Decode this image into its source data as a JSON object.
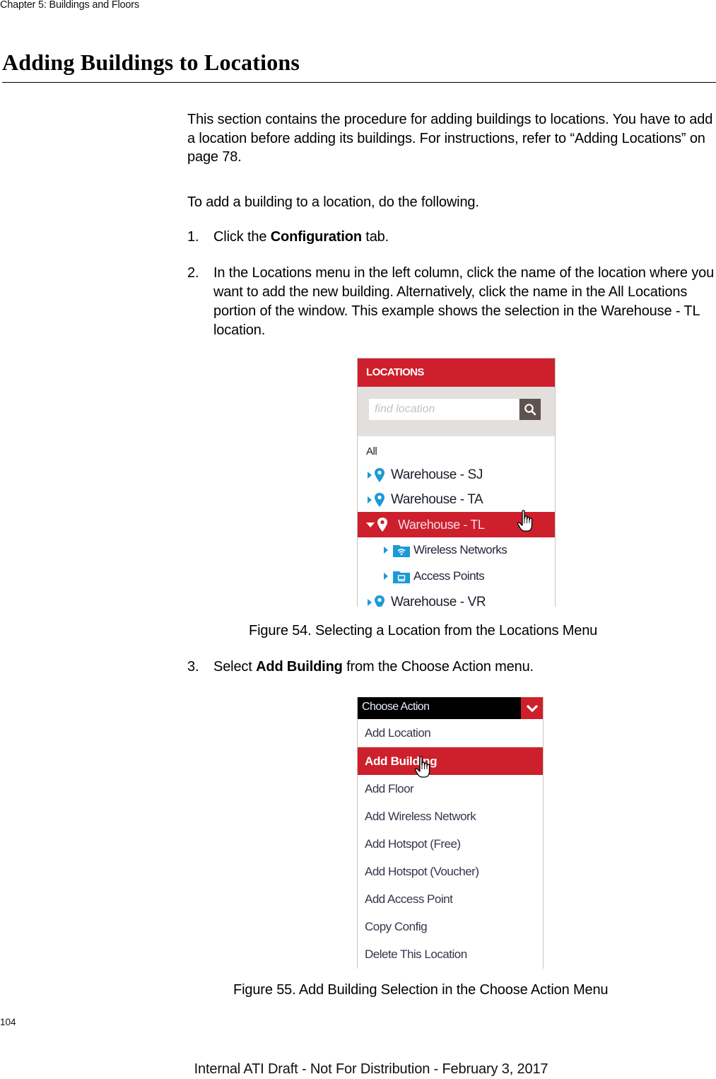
{
  "page": {
    "chapter_header": "Chapter 5: Buildings and Floors",
    "section_title": "Adding Buildings to Locations",
    "intro_paragraph": "This section contains the procedure for adding buildings to locations. You have to add a location before adding its buildings. For instructions, refer to “Adding Locations” on page 78.",
    "lead_in": "To add a building to a location, do the following.",
    "steps": [
      {
        "num": "1.",
        "before": "Click the ",
        "bold": "Configuration",
        "after": " tab."
      },
      {
        "num": "2.",
        "text": "In the Locations menu in the left column, click the name of the location where you want to add the new building. Alternatively, click the name in the All Locations portion of the window. This example shows the selection in the Warehouse - TL location."
      },
      {
        "num": "3.",
        "before": "Select ",
        "bold": "Add Building",
        "after": " from the Choose Action menu."
      }
    ],
    "page_number": "104",
    "footer": "Internal ATI Draft - Not For Distribution - February 3, 2017"
  },
  "figure54": {
    "caption": "Figure 54. Selecting a Location from the Locations Menu",
    "panel_title": "LOCATIONS",
    "search_placeholder": "find location",
    "search_icon": "search-icon",
    "all_label": "All",
    "locations": [
      {
        "label": "Warehouse - SJ",
        "icon": "map-pin-icon",
        "expanded": false,
        "selected": false
      },
      {
        "label": "Warehouse - TA",
        "icon": "map-pin-icon",
        "expanded": false,
        "selected": false
      },
      {
        "label": "Warehouse - TL",
        "icon": "map-pin-icon",
        "expanded": true,
        "selected": true,
        "children": [
          {
            "label": "Wireless Networks",
            "icon": "wifi-folder-icon"
          },
          {
            "label": "Access Points",
            "icon": "access-point-folder-icon"
          }
        ]
      },
      {
        "label": "Warehouse - VR",
        "icon": "map-pin-icon",
        "expanded": false,
        "selected": false
      }
    ],
    "colors": {
      "header_red": "#cd202c",
      "search_area": "#e2dfdc",
      "search_button": "#5e5350",
      "icon_blue": "#1b9ad6"
    }
  },
  "figure55": {
    "caption": "Figure 55. Add Building Selection in the Choose Action Menu",
    "menu_title": "Choose Action",
    "toggle_icon": "chevron-down-icon",
    "items": [
      {
        "label": "Add Location",
        "selected": false
      },
      {
        "label": "Add Building",
        "selected": true
      },
      {
        "label": "Add Floor",
        "selected": false
      },
      {
        "label": "Add Wireless Network",
        "selected": false
      },
      {
        "label": "Add Hotspot (Free)",
        "selected": false
      },
      {
        "label": "Add Hotspot (Voucher)",
        "selected": false
      },
      {
        "label": "Add Access Point",
        "selected": false
      },
      {
        "label": "Copy Config",
        "selected": false
      },
      {
        "label": "Delete This Location",
        "selected": false
      }
    ],
    "colors": {
      "header_black": "#000000",
      "selected_red": "#cd202c"
    }
  }
}
